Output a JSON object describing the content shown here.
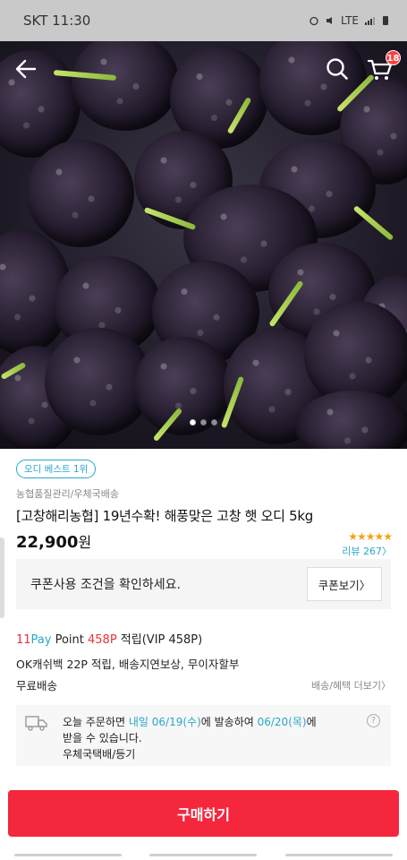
{
  "status_bar": {
    "carrier_time": "SKT 11:30",
    "right_text": "LTE"
  },
  "header": {
    "cart_count": "18",
    "icons": [
      "back-arrow-icon",
      "search-icon",
      "cart-icon"
    ]
  },
  "gallery": {
    "total": 3,
    "current": 1
  },
  "product": {
    "badge": "오디 베스트 1위",
    "seller": "농협품질관리/우체국배송",
    "title": "[고창해리농협] 19년수확! 해풍맞은 고창 햇 오디 5kg",
    "price": "22,900",
    "price_unit": "원",
    "rating_stars": "★★★★★",
    "review_label": "리뷰 267〉"
  },
  "coupon": {
    "text": "쿠폰사용 조건을 확인하세요.",
    "button": "쿠폰보기〉"
  },
  "point": {
    "prefix_11": "11",
    "prefix_pay": "Pay",
    "label": " Point ",
    "amount": "458P",
    "suffix": " 적립(VIP 458P)"
  },
  "benefits": {
    "ok_line": "OK캐쉬백 22P 적립, 배송지연보상, 무이자할부",
    "shipping": "무료배송",
    "more": "배송/혜택 더보기〉"
  },
  "delivery": {
    "t1": "오늘 주문하면 ",
    "d1": "내일 06/19(수)",
    "t2": "에 발송하여 ",
    "d2": "06/20(목)",
    "t3": "에",
    "line2": "받을 수 있습니다.",
    "line3": "우체국택배/등기",
    "help": "?"
  },
  "buy": {
    "label": "구매하기"
  },
  "colors": {
    "accent": "#f4273d",
    "link": "#2aa7c9",
    "star": "#f2a313"
  }
}
